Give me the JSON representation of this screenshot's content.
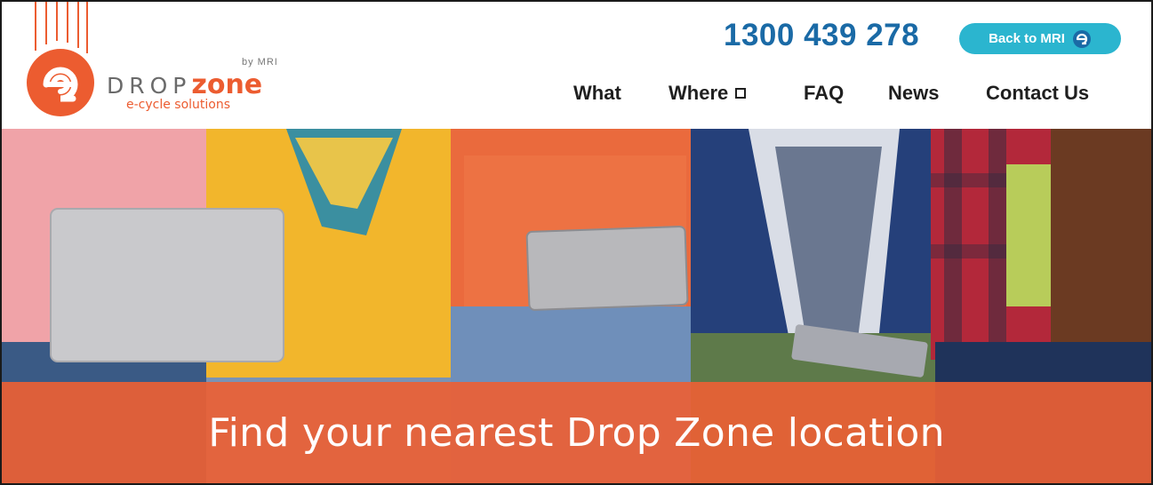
{
  "brand": {
    "name_part1": "DROP",
    "name_part2": "zone",
    "by_line": "by MRI",
    "tagline": "e-cycle solutions",
    "primary_color": "#ec5c30",
    "logo_icon": "dropzone-e-logo-icon"
  },
  "header": {
    "phone": "1300 439 278",
    "phone_color": "#1a6aa6",
    "back_button": "Back to MRI",
    "back_button_color": "#2bb5cf",
    "back_button_icon": "mri-e-icon"
  },
  "nav": {
    "items": [
      {
        "label": "What"
      },
      {
        "label": "Where",
        "icon": "dropdown-box-icon"
      },
      {
        "label": "FAQ"
      },
      {
        "label": "News"
      },
      {
        "label": "Contact Us"
      }
    ]
  },
  "hero": {
    "image_icon": "people-with-devices-photo",
    "banner_text": "Find your nearest Drop Zone location",
    "banner_color": "#ec6034"
  }
}
